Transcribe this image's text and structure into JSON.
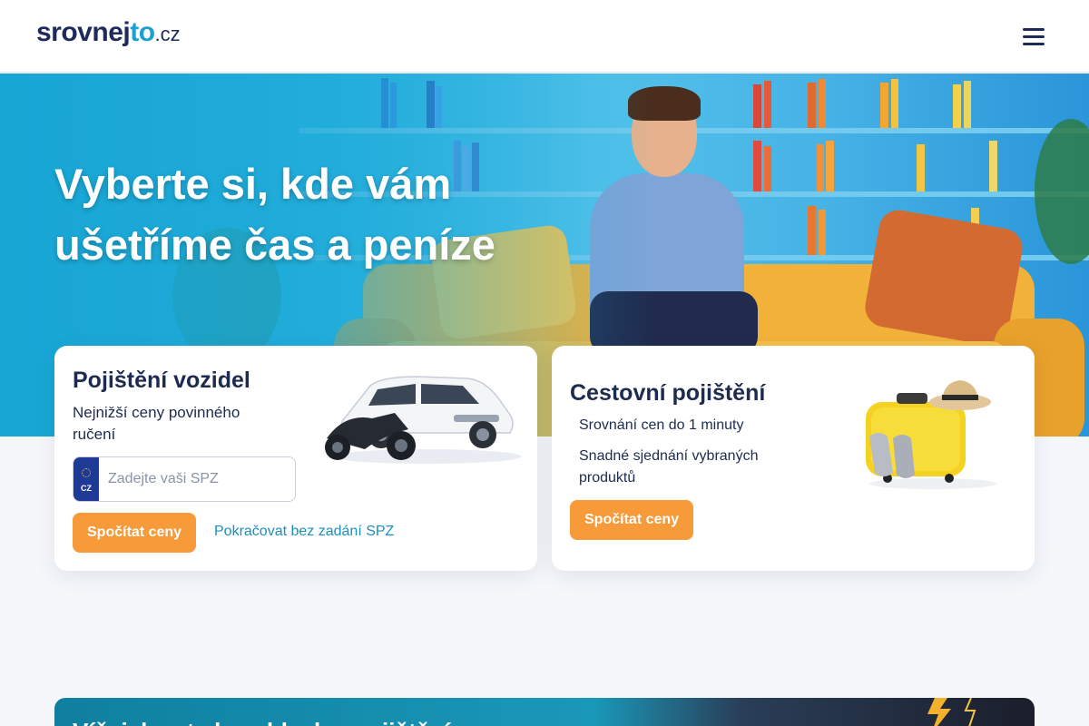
{
  "header": {
    "logo_main": "srovnej",
    "logo_accent": "to",
    "logo_tld": ".cz",
    "menu_icon": "hamburger-menu-icon"
  },
  "hero": {
    "title": "Vyberte si, kde vám ušetříme čas a peníze"
  },
  "vehicle_card": {
    "title": "Pojištění vozidel",
    "subtitle": "Nejnižší ceny povinného ručení",
    "plate_country": "CZ",
    "plate_placeholder": "Zadejte vaši SPZ",
    "submit_label": "Spočítat ceny",
    "skip_link": "Pokračovat bez zadání SPZ",
    "illustration": "car-and-motorcycle-illustration"
  },
  "travel_card": {
    "title": "Cestovní pojištění",
    "bullets": [
      "Srovnání cen do 1 minuty",
      "Snadné sjednání vybraných produktů"
    ],
    "submit_label": "Spočítat ceny",
    "illustration": "suitcase-with-hat-and-shoes-illustration"
  },
  "promo": {
    "title": "Víš, jak vet...ka a blesk... pojištění..."
  },
  "colors": {
    "brand_dark": "#1f2a5c",
    "brand_accent": "#1aa0d4",
    "cta_orange": "#f79b3a",
    "link_blue": "#1b8fbd"
  }
}
